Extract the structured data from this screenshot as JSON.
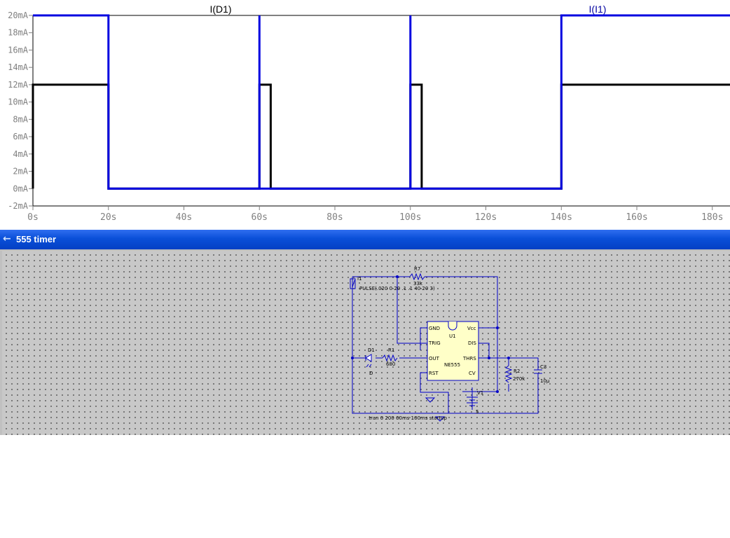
{
  "plot": {
    "trace_labels": [
      "I(D1)",
      "I(I1)"
    ],
    "colors": {
      "I(D1)": "#000000",
      "I(I1)": "#0000e0",
      "axis": "#808080",
      "frame": "#000000"
    }
  },
  "chart_data": {
    "type": "line",
    "title": "",
    "xlabel": "",
    "ylabel": "",
    "xlim": [
      0,
      185
    ],
    "ylim": [
      -2,
      20
    ],
    "x_ticks": [
      "0s",
      "20s",
      "40s",
      "60s",
      "80s",
      "100s",
      "120s",
      "140s",
      "160s",
      "180s"
    ],
    "y_ticks": [
      "-2mA",
      "0mA",
      "2mA",
      "4mA",
      "6mA",
      "8mA",
      "10mA",
      "12mA",
      "14mA",
      "16mA",
      "18mA",
      "20mA"
    ],
    "series": [
      {
        "name": "I(D1)",
        "color": "#000000",
        "x": [
          0,
          0,
          20,
          20,
          60,
          60,
          63,
          63,
          100,
          100,
          103,
          103,
          140,
          140,
          185
        ],
        "y": [
          0,
          12,
          12,
          0,
          0,
          12,
          12,
          0,
          0,
          12,
          12,
          0,
          0,
          12,
          12
        ]
      },
      {
        "name": "I(I1)",
        "color": "#0000e0",
        "x": [
          0,
          20,
          20,
          60,
          60,
          60,
          60,
          100,
          100,
          100,
          100,
          140,
          140,
          185
        ],
        "y": [
          20,
          20,
          0,
          0,
          20,
          20,
          0,
          0,
          20,
          20,
          0,
          0,
          20,
          20
        ]
      }
    ]
  },
  "schematic": {
    "title": "555 timer",
    "labels": {
      "i1": "I1",
      "pulse": "PULSE(.020 0 20 .1 .1 40 20 3)",
      "r7": "R7",
      "r7v": "33k",
      "u1": "U1",
      "gnd": "GND",
      "trig": "TRIG",
      "out": "OUT",
      "rst": "RST",
      "vcc": "Vcc",
      "dis": "DIS",
      "thrs": "THRS",
      "cv": "CV",
      "chip": "NE555",
      "d1": "D1",
      "d": "D",
      "r1": "R1",
      "r1v": "680",
      "r2": "R2",
      "r2v": "270k",
      "c3": "C3",
      "c3v": "10µ",
      "v1": "V1",
      "v1v": "5",
      "tran": ".tran 0 200 60ms 100ms startup"
    }
  }
}
